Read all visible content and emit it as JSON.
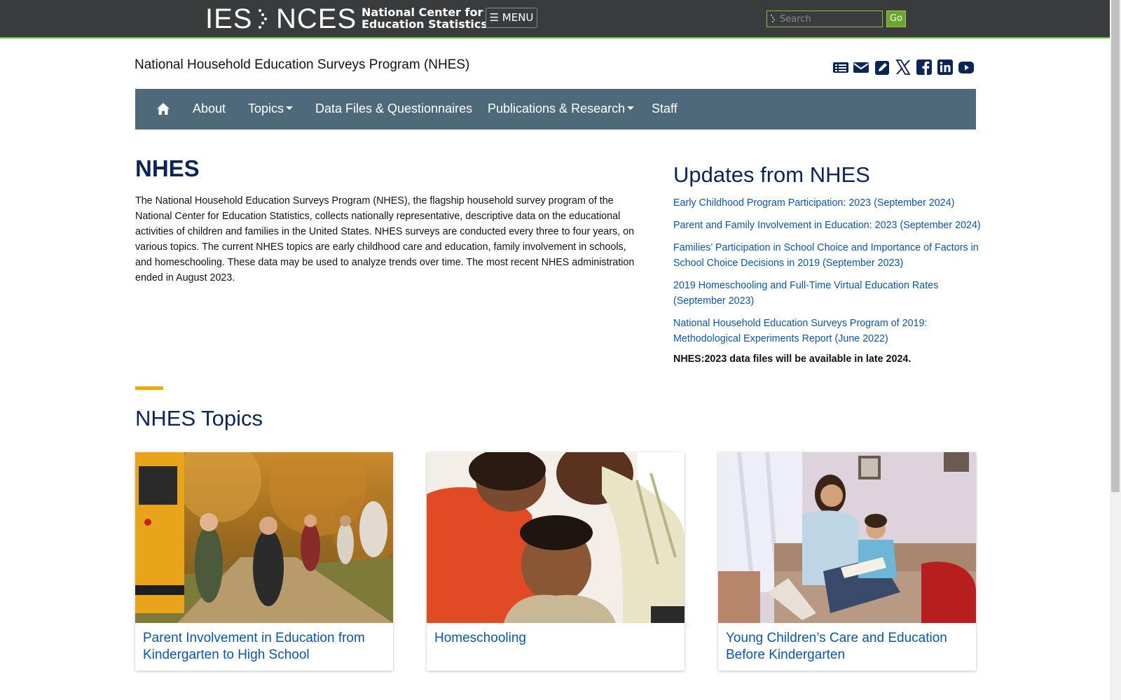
{
  "header": {
    "logo_ies": "IES",
    "logo_nces": "NCES",
    "logo_line1": "National Center for",
    "logo_line2": "Education Statistics",
    "menu_label": "☰ MENU",
    "search_placeholder": "Search",
    "go_label": "Go"
  },
  "program_title": "National Household Education Surveys Program (NHES)",
  "social_icons": [
    "newsflash-icon",
    "email-icon",
    "edit-icon",
    "x-twitter-icon",
    "facebook-icon",
    "linkedin-icon",
    "youtube-icon"
  ],
  "nav": {
    "items": [
      {
        "label": "About"
      },
      {
        "label": "Topics",
        "dropdown": true
      },
      {
        "label": "Data Files & Questionnaires"
      },
      {
        "label": "Publications & Research",
        "dropdown": true
      },
      {
        "label": "Staff"
      }
    ]
  },
  "main": {
    "heading": "NHES",
    "intro": "The National Household Education Surveys Program (NHES), the flagship household survey program of the National Center for Education Statistics, collects nationally representative, descriptive data on the educational activities of children and families in the United States. NHES surveys are conducted every three to four years, on various topics. The current NHES topics are early childhood care and education, family involvement in schools, and homeschooling. These data may be used to analyze trends over time. The most recent NHES administration ended in August 2023."
  },
  "updates": {
    "heading": "Updates from NHES",
    "links": [
      "Early Childhood Program Participation: 2023 (September 2024)",
      "Parent and Family Involvement in Education: 2023 (September 2024)",
      "Families’ Participation in School Choice and Importance of Factors in School Choice Decisions in 2019 (September 2023)",
      "2019 Homeschooling and Full-Time Virtual Education Rates (September 2023)",
      "National Household Education Surveys Program of 2019: Methodological Experiments Report (June 2022)"
    ],
    "note": "NHES:2023 data files will be available in late 2024."
  },
  "topics": {
    "heading": "NHES Topics",
    "cards": [
      {
        "title": "Parent Involvement in Education from Kindergarten to High School"
      },
      {
        "title": "Homeschooling"
      },
      {
        "title": "Young Children’s Care and Education Before Kindergarten"
      }
    ]
  },
  "colors": {
    "topbar": "#3a3b3c",
    "nav": "#4e6a7a",
    "heading": "#0b2559",
    "link": "#0b55a8",
    "accent": "#f2a900",
    "go_button": "#6aa629"
  }
}
